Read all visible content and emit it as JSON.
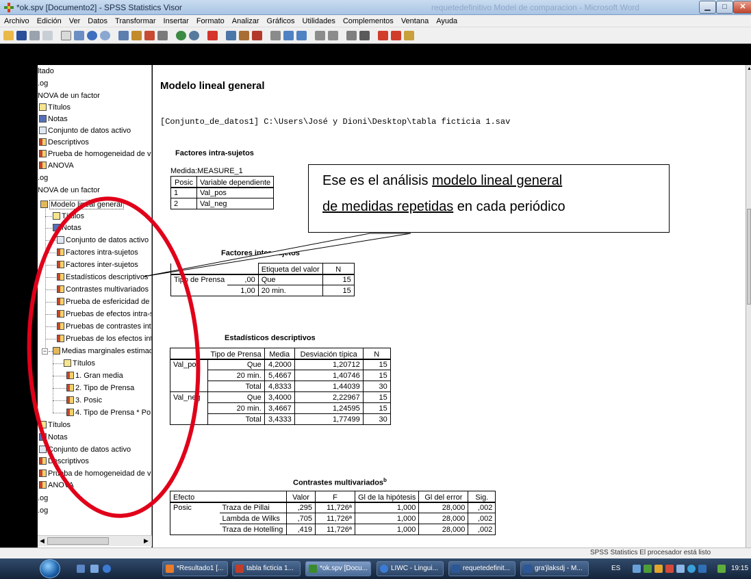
{
  "window": {
    "title": "*ok.spv [Documento2] - SPSS Statistics Visor",
    "background_title": "requetedefinitivo Model de comparacion - Microsoft Word"
  },
  "menu": [
    "Archivo",
    "Edición",
    "Ver",
    "Datos",
    "Transformar",
    "Insertar",
    "Formato",
    "Analizar",
    "Gráficos",
    "Utilidades",
    "Complementos",
    "Ventana",
    "Ayuda"
  ],
  "outline": {
    "items": [
      {
        "label": "ltado"
      },
      {
        "label": ".og"
      },
      {
        "label": "NOVA de un factor"
      },
      {
        "label": "Títulos"
      },
      {
        "label": "Notas"
      },
      {
        "label": "Conjunto de datos activo"
      },
      {
        "label": "Descriptivos"
      },
      {
        "label": "Prueba de homogeneidad de va"
      },
      {
        "label": "ANOVA"
      },
      {
        "label": ".og"
      },
      {
        "label": "NOVA de un factor"
      },
      {
        "label": "Modelo lineal general"
      },
      {
        "label": "Títulos"
      },
      {
        "label": "Notas"
      },
      {
        "label": "Conjunto de datos activo"
      },
      {
        "label": "Factores intra-sujetos"
      },
      {
        "label": "Factores inter-sujetos"
      },
      {
        "label": "Estadísticos descriptivos"
      },
      {
        "label": "Contrastes multivariados"
      },
      {
        "label": "Prueba de esfericidad de M"
      },
      {
        "label": "Pruebas de efectos intra-su"
      },
      {
        "label": "Pruebas de contrastes intra"
      },
      {
        "label": "Pruebas de los efectos inte"
      },
      {
        "label": "Medias marginales estimad"
      },
      {
        "label": "Títulos"
      },
      {
        "label": "1. Gran media"
      },
      {
        "label": "2. Tipo de Prensa"
      },
      {
        "label": "3. Posic"
      },
      {
        "label": "4. Tipo de Prensa * Po"
      },
      {
        "label": "Títulos"
      },
      {
        "label": "Notas"
      },
      {
        "label": "Conjunto de datos activo"
      },
      {
        "label": "Descriptivos"
      },
      {
        "label": "Prueba de homogeneidad de va"
      },
      {
        "label": "ANOVA"
      },
      {
        "label": ".og"
      },
      {
        "label": ".og"
      }
    ]
  },
  "content": {
    "heading": "Modelo lineal general",
    "dataset_line": "[Conjunto_de_datos1] C:\\Users\\José y Dioni\\Desktop\\tabla ficticia 1.sav",
    "within": {
      "title": "Factores intra-sujetos",
      "measure": "Medida:MEASURE_1",
      "h1": "Posic",
      "h2": "Variable dependiente",
      "rows": [
        [
          "1",
          "Val_pos"
        ],
        [
          "2",
          "Val_neg"
        ]
      ]
    },
    "between": {
      "title": "Factores inter-sujetos",
      "h_label": "Etiqueta del valor",
      "h_n": "N",
      "factor": "Tipo de Prensa",
      "rows": [
        [
          ",00",
          "Que",
          "15"
        ],
        [
          "1,00",
          "20 min.",
          "15"
        ]
      ]
    },
    "descriptives": {
      "title": "Estadísticos descriptivos",
      "h_tipo": "Tipo de Prensa",
      "h_media": "Media",
      "h_desv": "Desviación típica",
      "h_n": "N",
      "groups": [
        {
          "var": "Val_pos",
          "rows": [
            [
              "Que",
              "4,2000",
              "1,20712",
              "15"
            ],
            [
              "20 min.",
              "5,4667",
              "1,40746",
              "15"
            ],
            [
              "Total",
              "4,8333",
              "1,44039",
              "30"
            ]
          ]
        },
        {
          "var": "Val_neg",
          "rows": [
            [
              "Que",
              "3,4000",
              "2,22967",
              "15"
            ],
            [
              "20 min.",
              "3,4667",
              "1,24595",
              "15"
            ],
            [
              "Total",
              "3,4333",
              "1,77499",
              "30"
            ]
          ]
        }
      ]
    },
    "multivariate": {
      "title": "Contrastes multivariados",
      "title_sup": "b",
      "h_efecto": "Efecto",
      "h_valor": "Valor",
      "h_f": "F",
      "h_gl_hip": "Gl de la hipótesis",
      "h_gl_err": "Gl del error",
      "h_sig": "Sig.",
      "effect": "Posic",
      "rows": [
        [
          "Traza de Pillai",
          ",295",
          "11,726ª",
          "1,000",
          "28,000",
          ",002"
        ],
        [
          "Lambda de Wilks",
          ",705",
          "11,726ª",
          "1,000",
          "28,000",
          ",002"
        ],
        [
          "Traza de Hotelling",
          ",419",
          "11,726ª",
          "1,000",
          "28,000",
          ",002"
        ]
      ]
    }
  },
  "callout": {
    "line1_plain": "Ese es el análisis ",
    "line1_underlined": "modelo lineal general",
    "line2_underlined": "de medidas repetidas",
    "line2_plain": " en cada periódico"
  },
  "status_text": "SPSS Statistics  El procesador está listo",
  "taskbar": {
    "tasks": [
      "*Resultado1 [...",
      "tabla ficticia 1...",
      "*ok.spv [Docu...",
      "LIWC - Lingui...",
      "requetedefinit...",
      "gra'jlaksdj - M..."
    ],
    "lang": "ES",
    "clock": "19:15"
  },
  "colors": {
    "accent_red": "#e0001a",
    "title_gradient_top": "#c9dcf0",
    "taskbar": "#1f3350"
  }
}
